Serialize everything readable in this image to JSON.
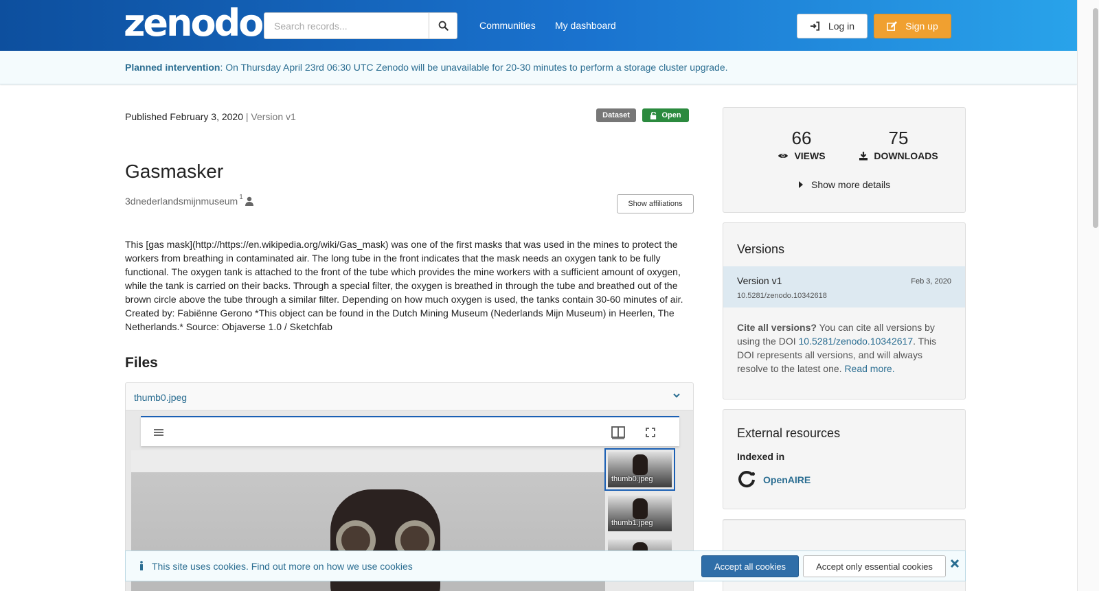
{
  "header": {
    "logo": "zenodo",
    "search_placeholder": "Search records...",
    "nav": [
      "Communities",
      "My dashboard"
    ],
    "login_label": "Log in",
    "signup_label": "Sign up"
  },
  "banner": {
    "bold": "Planned intervention",
    "text": ": On Thursday April 23rd 06:30 UTC Zenodo will be unavailable for 20-30 minutes to perform a storage cluster upgrade."
  },
  "record": {
    "published": "Published February 3, 2020",
    "version": "| Version v1",
    "badge_type": "Dataset",
    "badge_access": "Open",
    "title": "Gasmasker",
    "creator": "3dnederlandsmijnmuseum",
    "creator_sup": "1",
    "affiliations_label": "Show affiliations",
    "description": "This [gas mask](http://https://en.wikipedia.org/wiki/Gas_mask) was one of the first masks that was used in the mines to protect the workers from breathing in contaminated air. The long tube in the front indicates that the mask needs an oxygen tank to be fully functional. The oxygen tank is attached to the front of the tube which provides the mine workers with a sufficient amount of oxygen, while the tank is carried on their backs. Through a special filter, the oxygen is breathed in through the tube and breathed out of the brown circle above the tube through a similar filter. Depending on how much oxygen is used, the tanks contain 30-60 minutes of air. Created by: Fabiënne Gerono *This object can be found in the Dutch Mining Museum (Nederlands Mijn Museum) in Heerlen, The Netherlands.* Source: Objaverse 1.0 / Sketchfab",
    "files_heading": "Files",
    "file_name": "thumb0.jpeg",
    "thumbs": [
      "thumb0.jpeg",
      "thumb1.jpeg"
    ]
  },
  "sidebar": {
    "views_count": "66",
    "views_label": "VIEWS",
    "downloads_count": "75",
    "downloads_label": "DOWNLOADS",
    "more_details": "Show more details",
    "versions_heading": "Versions",
    "version_name": "Version v1",
    "version_date": "Feb 3, 2020",
    "version_doi": "10.5281/zenodo.10342618",
    "cite_bold": "Cite all versions?",
    "cite_text1": " You can cite all versions by using the DOI ",
    "cite_doi": "10.5281/zenodo.10342617",
    "cite_text2": ". This DOI represents all versions, and will always resolve to the latest one. ",
    "read_more": "Read more.",
    "external_heading": "External resources",
    "indexed_in": "Indexed in",
    "openaire": "OpenAIRE"
  },
  "cookie": {
    "text": "This site uses cookies. Find out more on ",
    "link": "how we use cookies",
    "accept_all": "Accept all cookies",
    "accept_essential": "Accept only essential cookies"
  },
  "colors": {
    "header_dark": "#0d4f9e",
    "header_light": "#29a3ea",
    "signup": "#f0a030",
    "link": "#2a6d91",
    "open_badge": "#2b8a3e"
  }
}
